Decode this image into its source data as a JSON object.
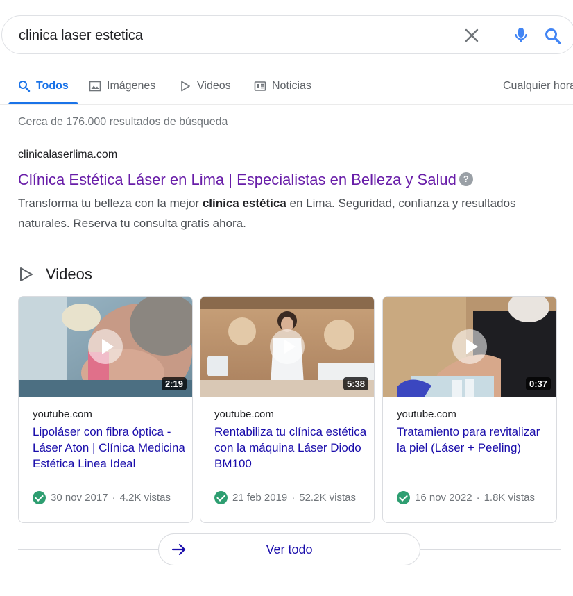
{
  "search": {
    "query": "clinica laser estetica",
    "icons": {
      "clear": "close-icon",
      "mic": "microphone-icon",
      "search": "search-icon"
    },
    "colors": {
      "mic": "#4285f4",
      "search": "#4285f4"
    }
  },
  "tabs": [
    {
      "label": "Todos",
      "icon": "search-icon",
      "active": true
    },
    {
      "label": "Imágenes",
      "icon": "image-icon",
      "active": false
    },
    {
      "label": "Videos",
      "icon": "play-icon",
      "active": false
    },
    {
      "label": "Noticias",
      "icon": "news-icon",
      "active": false
    }
  ],
  "tools": {
    "time_filter": "Cualquier hora"
  },
  "stats": "Cerca de 176.000 resultados de búsqueda",
  "result": {
    "url": "clinicalaserlima.com",
    "title": "Clínica Estética Láser en Lima | Especialistas en Belleza y Salud",
    "help": "?",
    "snippet_pre": "Transforma tu belleza con la mejor ",
    "snippet_bold": "clínica estética",
    "snippet_post": " en Lima. Seguridad, confianza y resultados naturales. Reserva tu consulta gratis ahora."
  },
  "videos": {
    "heading": "Videos",
    "items": [
      {
        "source": "youtube.com",
        "title": "Lipoláser con fibra óptica - Láser Aton | Clínica Medicina Estética Linea Ideal",
        "date": "30 nov 2017",
        "sep": "·",
        "views": "4.2K vistas",
        "duration": "2:19"
      },
      {
        "source": "youtube.com",
        "title": "Rentabiliza tu clínica estética con la máquina Láser Diodo BM100",
        "date": "21 feb 2019",
        "sep": "·",
        "views": "52.2K vistas",
        "duration": "5:38"
      },
      {
        "source": "youtube.com",
        "title": "Tratamiento para revitalizar la piel (Láser + Peeling)",
        "date": "16 nov 2022",
        "sep": "·",
        "views": "1.8K vistas",
        "duration": "0:37"
      }
    ],
    "see_all": "Ver todo"
  },
  "colors": {
    "link": "#1a0dab",
    "visited": "#681da8",
    "active_tab": "#1a73e8",
    "verified": "#2e9e71"
  }
}
